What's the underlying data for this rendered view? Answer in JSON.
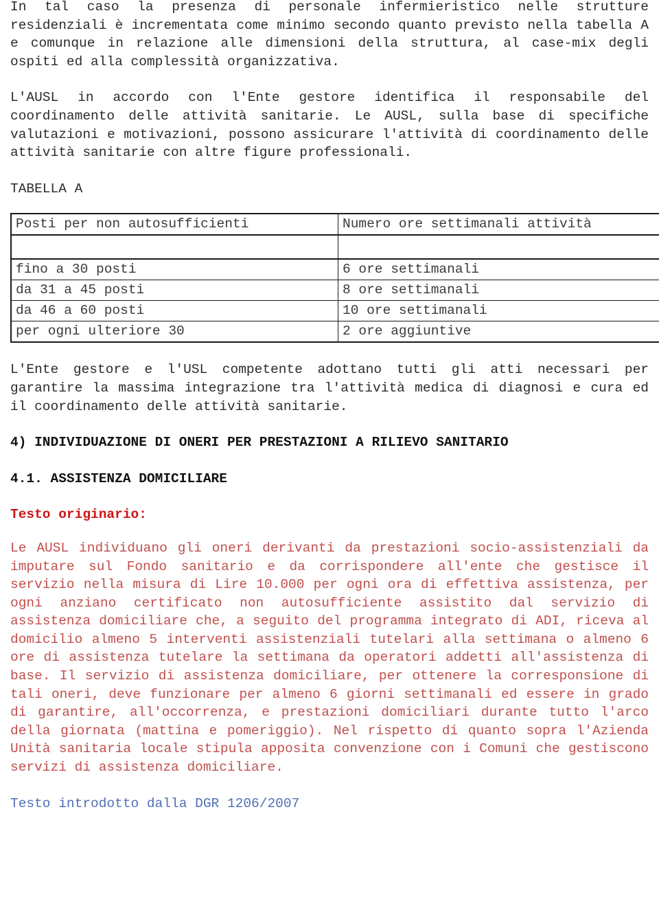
{
  "document": {
    "paragraphs": {
      "p1": "In tal caso la presenza di personale infermieristico nelle strutture residenziali è incrementata come minimo secondo quanto previsto nella tabella A e comunque in relazione alle dimensioni della struttura, al case-mix degli ospiti ed alla complessità organizzativa.",
      "p2": "L'AUSL in accordo con l'Ente gestore identifica il responsabile del coordinamento delle attività sanitarie. Le AUSL, sulla base di specifiche valutazioni e motivazioni, possono assicurare l'attività di coordinamento delle attività sanitarie con altre figure professionali.",
      "p3": "L'Ente gestore e l'USL competente adottano tutti gli atti necessari per garantire la massima integrazione tra l'attività medica di diagnosi e cura ed il coordinamento delle attività sanitarie."
    },
    "table_label": "TABELLA A",
    "table": {
      "headers": [
        "Posti per non autosufficienti",
        "Numero ore settimanali attività"
      ],
      "spacer_row": [
        "",
        ""
      ],
      "rows": [
        [
          "fino a 30 posti",
          "6 ore settimanali"
        ],
        [
          "da 31 a 45 posti",
          "8 ore settimanali"
        ],
        [
          "da 46 a 60 posti",
          "10 ore settimanali"
        ],
        [
          "per ogni ulteriore 30",
          "2 ore aggiuntive"
        ]
      ]
    },
    "section_heading": "4) INDIVIDUAZIONE DI ONERI PER PRESTAZIONI A RILIEVO SANITARIO",
    "sub_heading": "4.1. ASSISTENZA DOMICILIARE",
    "label_testo_originario": "Testo originario:",
    "testo_originario": "Le AUSL individuano gli oneri derivanti da prestazioni socio-assistenziali da imputare sul Fondo sanitario e da corrispondere all'ente che gestisce il servizio nella misura di Lire 10.000 per ogni ora di effettiva assistenza, per ogni anziano certificato non autosufficiente assistito dal servizio di assistenza domiciliare che, a seguito del programma integrato di ADI, riceva al domicilio almeno 5 interventi assistenziali tutelari alla settimana o almeno 6 ore di assistenza tutelare la settimana da operatori addetti all'assistenza di base. Il servizio di assistenza domiciliare, per ottenere la corresponsione di tali oneri, deve funzionare per almeno 6 giorni settimanali ed essere in grado di garantire, all'occorrenza, e prestazioni domiciliari durante tutto l'arco della giornata (mattina e pomeriggio). Nel rispetto di quanto sopra l'Azienda Unità sanitaria locale stipula apposita convenzione con i Comuni che gestiscono servizi di assistenza domiciliare.",
    "label_testo_introdotto": "Testo introdotto dalla DGR 1206/2007"
  },
  "colors": {
    "body_text": "#2b2b2b",
    "heading": "#111111",
    "red_label": "#cc1417",
    "red_body": "#c0504d",
    "blue_label": "#4f6fb5",
    "table_border": "#1a1a1a"
  }
}
